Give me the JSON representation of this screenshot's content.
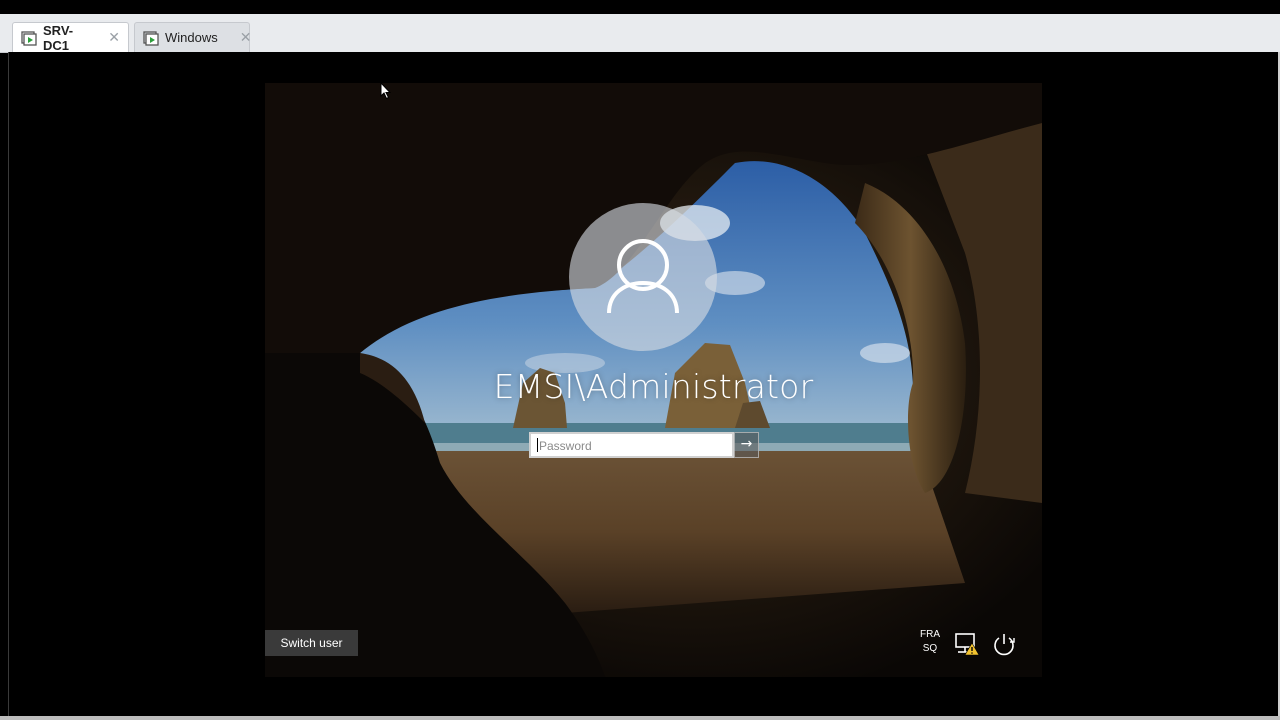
{
  "tabs": [
    {
      "label": "SRV-DC1",
      "active": true,
      "icon": "vm-play-icon"
    },
    {
      "label": "Windows",
      "active": false,
      "icon": "vm-play-icon"
    }
  ],
  "tab_close_glyph": "✕",
  "lockscreen": {
    "username": "EMSI\\Administrator",
    "password": {
      "value": "",
      "placeholder": "Password"
    },
    "submit_glyph": "→",
    "switch_user_label": "Switch user",
    "language": {
      "line1": "FRA",
      "line2": "SQ"
    },
    "tray_icons": [
      "network-warning-icon",
      "power-icon"
    ]
  },
  "colors": {
    "tab_active_bg": "#ffffff",
    "tab_inactive_bg": "#dde0e4",
    "tabbar_bg": "#e9ebee",
    "switch_user_bg": "#3a3a3a",
    "warning_accent": "#f2c230"
  }
}
